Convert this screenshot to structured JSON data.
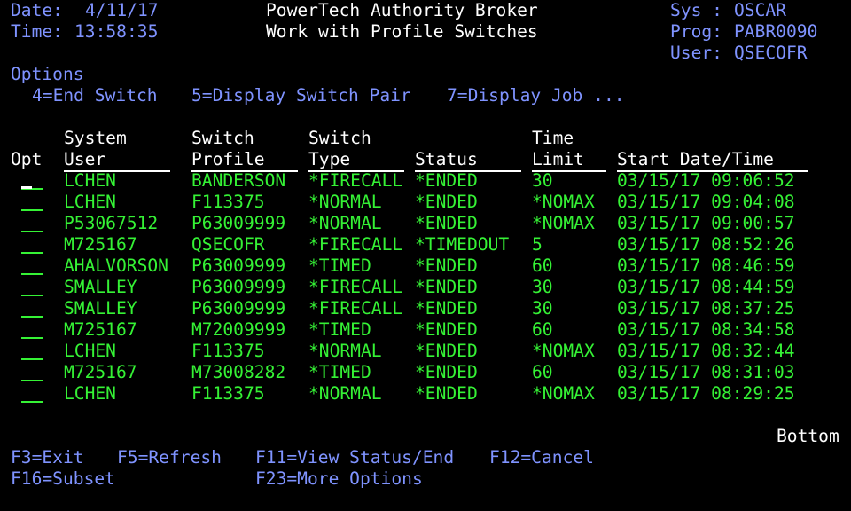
{
  "header": {
    "date_label": "Date:",
    "date_value": "4/11/17",
    "time_label": "Time:",
    "time_value": "13:58:35",
    "title": "PowerTech Authority Broker",
    "subtitle": "Work with Profile Switches",
    "sys_label": "Sys :",
    "sys_value": "OSCAR",
    "prog_label": "Prog:",
    "prog_value": "PABR0090",
    "user_label": "User:",
    "user_value": "QSECOFR"
  },
  "options": {
    "label": "Options",
    "items": [
      "4=End Switch",
      "5=Display Switch Pair",
      "7=Display Job ..."
    ]
  },
  "columns": {
    "opt": "Opt",
    "system_user": [
      "System",
      "User"
    ],
    "switch_profile": [
      "Switch",
      "Profile"
    ],
    "switch_type": [
      "Switch",
      "Type"
    ],
    "status": "Status",
    "time_limit": [
      "Time",
      "Limit"
    ],
    "start": "Start Date/Time"
  },
  "rows": [
    {
      "user": "LCHEN",
      "profile": "BANDERSON",
      "type": "*FIRECALL",
      "status": "*ENDED",
      "limit": "30",
      "start": "03/15/17 09:06:52"
    },
    {
      "user": "LCHEN",
      "profile": "F113375",
      "type": "*NORMAL",
      "status": "*ENDED",
      "limit": "*NOMAX",
      "start": "03/15/17 09:04:08"
    },
    {
      "user": "P53067512",
      "profile": "P63009999",
      "type": "*NORMAL",
      "status": "*ENDED",
      "limit": "*NOMAX",
      "start": "03/15/17 09:00:57"
    },
    {
      "user": "M725167",
      "profile": "QSECOFR",
      "type": "*FIRECALL",
      "status": "*TIMEDOUT",
      "limit": "5",
      "start": "03/15/17 08:52:26"
    },
    {
      "user": "AHALVORSON",
      "profile": "P63009999",
      "type": "*TIMED",
      "status": "*ENDED",
      "limit": "60",
      "start": "03/15/17 08:46:59"
    },
    {
      "user": "SMALLEY",
      "profile": "P63009999",
      "type": "*FIRECALL",
      "status": "*ENDED",
      "limit": "30",
      "start": "03/15/17 08:44:59"
    },
    {
      "user": "SMALLEY",
      "profile": "P63009999",
      "type": "*FIRECALL",
      "status": "*ENDED",
      "limit": "30",
      "start": "03/15/17 08:37:25"
    },
    {
      "user": "M725167",
      "profile": "M72009999",
      "type": "*TIMED",
      "status": "*ENDED",
      "limit": "60",
      "start": "03/15/17 08:34:58"
    },
    {
      "user": "LCHEN",
      "profile": "F113375",
      "type": "*NORMAL",
      "status": "*ENDED",
      "limit": "*NOMAX",
      "start": "03/15/17 08:32:44"
    },
    {
      "user": "M725167",
      "profile": "M73008282",
      "type": "*TIMED",
      "status": "*ENDED",
      "limit": "60",
      "start": "03/15/17 08:31:03"
    },
    {
      "user": "LCHEN",
      "profile": "F113375",
      "type": "*NORMAL",
      "status": "*ENDED",
      "limit": "*NOMAX",
      "start": "03/15/17 08:29:25"
    }
  ],
  "more_indicator": "Bottom",
  "fkeys": {
    "f3": "F3=Exit",
    "f5": "F5=Refresh",
    "f11": "F11=View Status/End",
    "f12": "F12=Cancel",
    "f16": "F16=Subset",
    "f23": "F23=More Options"
  },
  "colors": {
    "background": "#000000",
    "field_label": "#7f93ff",
    "heading": "#ffffff",
    "data": "#35f235"
  }
}
